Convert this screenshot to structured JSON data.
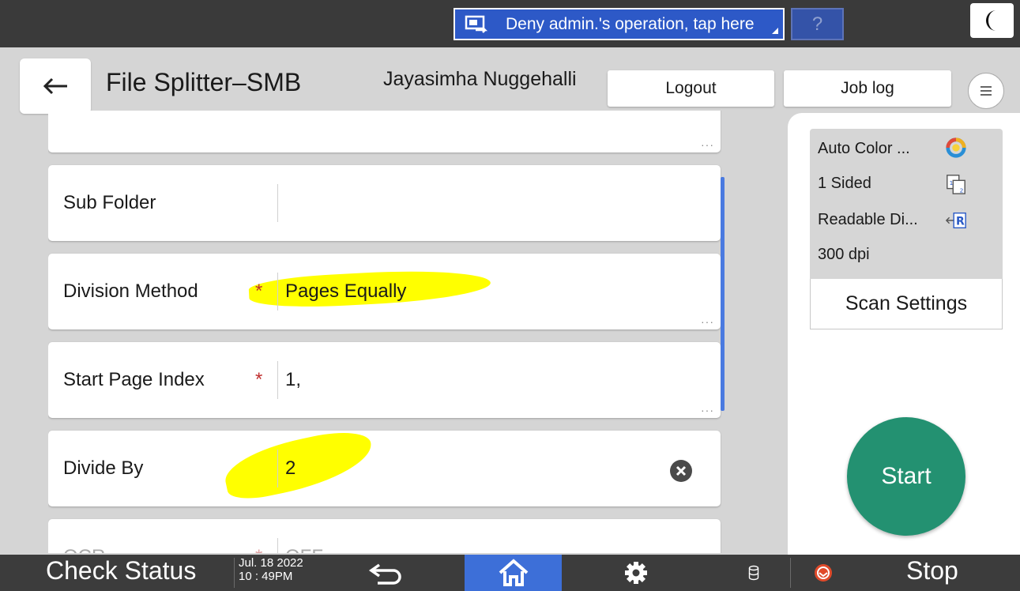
{
  "topbar": {
    "admin_notice": "Deny admin.'s operation, tap here",
    "help_label": "?"
  },
  "header": {
    "title": "File Splitter–SMB",
    "user": "Jayasimha Nuggehalli",
    "logout_label": "Logout",
    "joblog_label": "Job log"
  },
  "form": {
    "rows": [
      {
        "label": "Sub Folder",
        "value": "",
        "required": false
      },
      {
        "label": "Division Method",
        "value": "Pages Equally",
        "required": true
      },
      {
        "label": "Start Page Index",
        "value": "1,",
        "required": true
      },
      {
        "label": "Divide By",
        "value": "2",
        "required": false
      },
      {
        "label": "OCR",
        "value": "OFF",
        "required": true
      }
    ],
    "required_mark": "*",
    "more_dots": "···"
  },
  "scan": {
    "color": "Auto Color ...",
    "sides": "1 Sided",
    "orientation": "Readable Di...",
    "resolution": "300 dpi",
    "settings_label": "Scan Settings",
    "start_label": "Start"
  },
  "bottombar": {
    "check_status": "Check Status",
    "date": "Jul. 18 2022",
    "time": "10 : 49PM",
    "stop_label": "Stop"
  },
  "colors": {
    "accent_blue": "#2d59c7",
    "start_green": "#239171",
    "highlight": "#ffff00",
    "required_red": "#c03030"
  }
}
